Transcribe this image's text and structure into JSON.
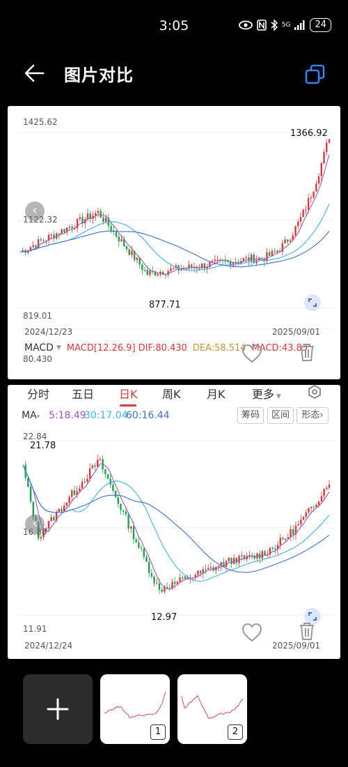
{
  "status": {
    "time": "3:05",
    "network": "5G",
    "battery": "24"
  },
  "header": {
    "title": "图片对比"
  },
  "panel1": {
    "price_high": "1425.62",
    "peak_label": "1366.92",
    "price_mid": "1122.32",
    "low_label": "877.71",
    "price_low": "819.01",
    "date_start": "2024/12/23",
    "date_end": "2025/09/01",
    "macd_tag": "MACD",
    "macd_text": "MACD[12.26.9]",
    "dif": "DIF:80.430",
    "dea": "DEA:58.514",
    "macd": "MACD:43.83",
    "macd_axis": "80.430",
    "chart_data": {
      "type": "candlestick",
      "x_range": [
        "2024/12/23",
        "2025/09/01"
      ],
      "ylim": [
        819.01,
        1425.62
      ],
      "annotations": {
        "high": 1366.92,
        "low": 877.71
      }
    }
  },
  "panel2": {
    "tabs": [
      "分时",
      "五日",
      "日K",
      "周K",
      "月K",
      "更多"
    ],
    "active_tab": "日K",
    "ma5": "5:18.49",
    "ma30": "30:17.04",
    "ma60": "60:16.44",
    "btn_chips": "筹码",
    "btn_range": "区间",
    "btn_shape": "形态",
    "price_high": "22.84",
    "peak_label": "21.78",
    "price_mid": "16.88",
    "low_label": "12.97",
    "price_low": "11.91",
    "date_start": "2024/12/24",
    "date_end": "2025/09/01",
    "chart_data": {
      "type": "candlestick",
      "x_range": [
        "2024/12/24",
        "2025/09/01"
      ],
      "ylim": [
        11.91,
        22.84
      ],
      "annotations": {
        "high": 21.78,
        "low": 12.97
      },
      "series": [
        {
          "name": "MA5",
          "value": 18.49
        },
        {
          "name": "MA30",
          "value": 17.04
        },
        {
          "name": "MA60",
          "value": 16.44
        }
      ]
    }
  },
  "thumbnails": [
    {
      "number": "1"
    },
    {
      "number": "2"
    }
  ],
  "colors": {
    "up": "#e0353a",
    "down": "#1aa34a",
    "ma_short": "#9b59b6",
    "ma_mid": "#3fb3e6",
    "ma_long": "#3d6fd6"
  }
}
